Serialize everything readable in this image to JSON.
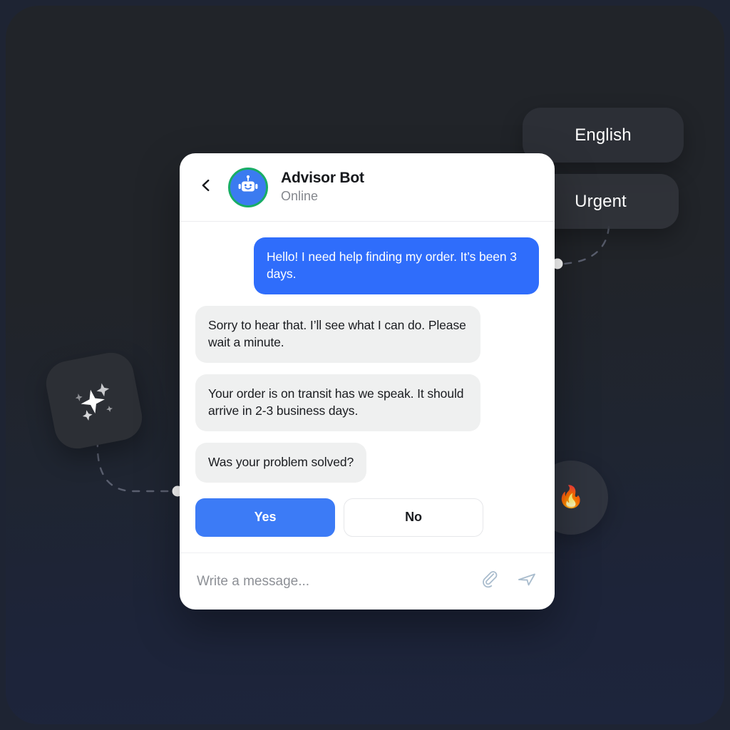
{
  "theme": {
    "outer_bg": "#1e2433",
    "panel_top": "#212429",
    "panel_bottom": "#1d253c",
    "accent_blue": "#2f6dfb",
    "button_blue": "#3c7bf6",
    "status_green": "#18ad65",
    "bubble_gray": "#eff0f0",
    "icon_gray": "#a9bccd"
  },
  "tags": [
    {
      "label": "English",
      "name": "tag-pill-english"
    },
    {
      "label": "Urgent",
      "name": "tag-pill-urgent"
    }
  ],
  "floating": {
    "sparkle_icon": "sparkles-icon",
    "fire_emoji": "🔥",
    "fire_icon": "fire-emoji-icon"
  },
  "chat": {
    "header": {
      "back_icon": "chevron-left-icon",
      "avatar_icon": "robot-avatar-icon",
      "name": "Advisor Bot",
      "status": "Online"
    },
    "messages": [
      {
        "id": "msg-1",
        "side": "out",
        "text": "Hello! I need help finding my order. It’s been 3 days."
      },
      {
        "id": "msg-2",
        "side": "in",
        "text": "Sorry to hear that. I’ll see what I can do. Please wait a minute."
      },
      {
        "id": "msg-3",
        "side": "in",
        "text": "Your order is on transit has we speak. It should arrive in 2-3 business days."
      },
      {
        "id": "msg-4",
        "side": "in",
        "text": "Was your problem solved?"
      }
    ],
    "quick_replies": [
      {
        "label": "Yes",
        "style": "primary",
        "name": "quick-reply-yes"
      },
      {
        "label": "No",
        "style": "secondary",
        "name": "quick-reply-no"
      }
    ],
    "composer": {
      "placeholder": "Write a message...",
      "value": "",
      "attach_icon": "paperclip-icon",
      "send_icon": "send-icon"
    }
  }
}
